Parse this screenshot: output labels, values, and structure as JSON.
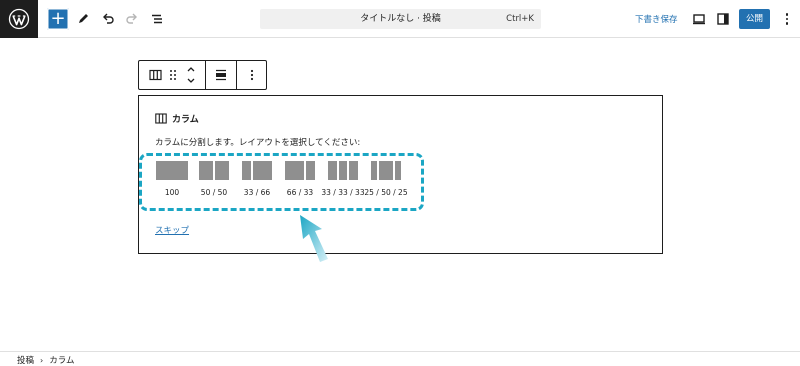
{
  "header": {
    "logo_icon": "wordpress-logo-icon",
    "add_block_label": "+",
    "document_title": "タイトルなし · 投稿",
    "shortcut": "Ctrl+K",
    "save_draft_label": "下書き保存",
    "publish_label": "公開",
    "accent_color": "#2271b1"
  },
  "block_toolbar": {
    "icons": [
      "columns-block-icon",
      "drag-handle-icon",
      "move-up-down-icon",
      "align-icon",
      "more-options-icon"
    ]
  },
  "placeholder": {
    "block_name": "カラム",
    "instructions": "カラムに分割します。レイアウトを選択してください:",
    "variations": [
      {
        "label": "100",
        "columns": [
          100
        ]
      },
      {
        "label": "50 / 50",
        "columns": [
          50,
          50
        ]
      },
      {
        "label": "33 / 66",
        "columns": [
          33,
          66
        ]
      },
      {
        "label": "66 / 33",
        "columns": [
          66,
          33
        ]
      },
      {
        "label": "33 / 33 / 33",
        "columns": [
          33,
          33,
          33
        ]
      },
      {
        "label": "25 / 50 / 25",
        "columns": [
          25,
          50,
          25
        ]
      }
    ],
    "skip_label": "スキップ"
  },
  "annotation": {
    "highlight_color": "#1ba6c4"
  },
  "footer": {
    "breadcrumbs": [
      "投稿",
      "カラム"
    ]
  }
}
